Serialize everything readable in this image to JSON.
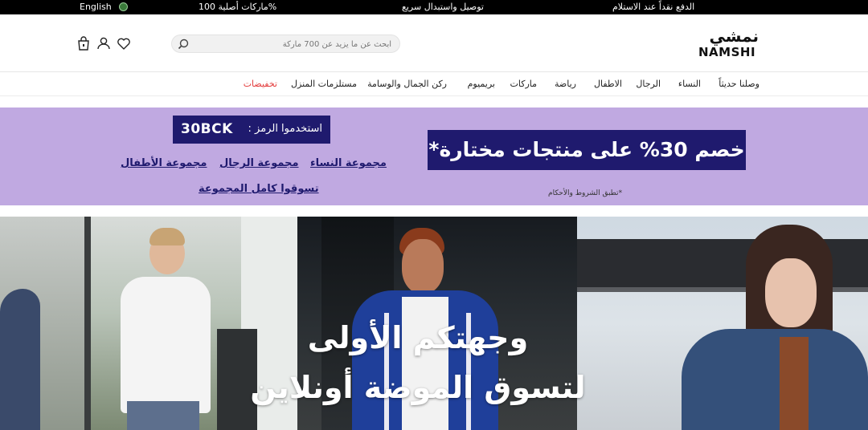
{
  "topbar": {
    "language": "English",
    "original_brands": "ماركات أصلية 100%",
    "fast_delivery": "توصيل واستبدال سريع",
    "cash_on_delivery": "الدفع نقداً عند الاستلام"
  },
  "header": {
    "logo_ar": "نمشي",
    "logo_en": "NAMSHI",
    "search_placeholder": "ابحث عن ما يزيد عن 700 ماركة",
    "icons": [
      "cart-icon",
      "user-icon",
      "heart-icon",
      "search-icon"
    ]
  },
  "nav": {
    "items": [
      "وصلنا حديثاً",
      "النساء",
      "الرجال",
      "الاطفال",
      "رياضة",
      "ماركات",
      "بريميوم",
      "ركن الجمال والوسامة",
      "مستلزمات المنزل",
      "تخفيضات"
    ]
  },
  "promo": {
    "discount": "خصم 30% على منتجات مختارة*",
    "code_label": "استخدموا الرمز :",
    "code": "30BCK",
    "links": [
      "مجموعة النساء",
      "مجموعة الرجال",
      "مجموعة الأطفال",
      "تسوقوا كامل المجموعة"
    ],
    "terms": "*تطبق الشروط والأحكام"
  },
  "hero": {
    "line1": "وجهتكم الأولى",
    "line2": "لتسوق الموضة أونلاين"
  },
  "colors": {
    "promo_bg": "#c0a9e1",
    "promo_dark": "#1f1a6e",
    "sale_red": "#e33b3b",
    "topbar_bg": "#000000"
  }
}
